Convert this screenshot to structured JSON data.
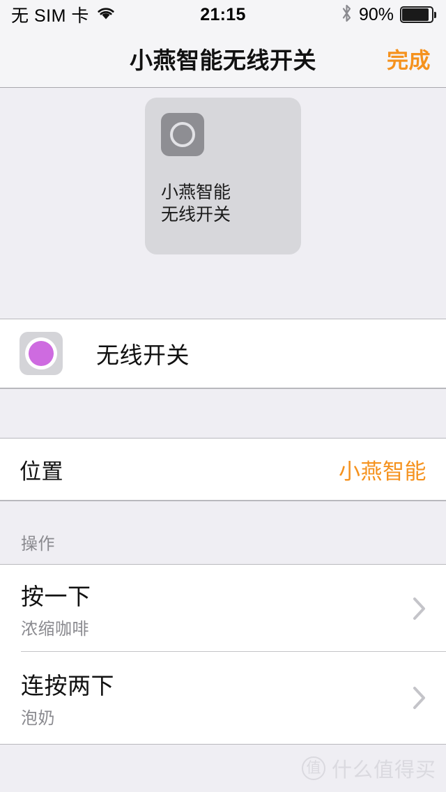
{
  "status_bar": {
    "carrier": "无 SIM 卡",
    "wifi_icon": "wifi-icon",
    "time": "21:15",
    "bluetooth_icon": "bluetooth-icon",
    "battery_percent": "90%",
    "battery_icon": "battery-icon",
    "battery_level": 90
  },
  "nav_bar": {
    "title": "小燕智能无线开关",
    "done_label": "完成",
    "done_color": "#F5921E"
  },
  "hero": {
    "card": {
      "icon_name": "switch-circle-icon",
      "device_name": "小燕智能\n无线开关",
      "device_name_line1": "小燕智能",
      "device_name_line2": "无线开关",
      "card_color": "#D7D7DB",
      "tile_color": "#8E8E93"
    }
  },
  "accessory_row": {
    "icon_name": "wireless-switch-icon",
    "icon_accent": "#CE6BE0",
    "label": "无线开关"
  },
  "location_row": {
    "label": "位置",
    "value": "小燕智能",
    "value_color": "#F5921E"
  },
  "actions_section": {
    "header": "操作",
    "items": [
      {
        "title": "按一下",
        "subtitle": "浓缩咖啡",
        "chevron_icon": "chevron-right-icon"
      },
      {
        "title": "连按两下",
        "subtitle": "泡奶",
        "chevron_icon": "chevron-right-icon"
      }
    ]
  },
  "watermark": {
    "logo_text": "值",
    "text": "什么值得买"
  }
}
